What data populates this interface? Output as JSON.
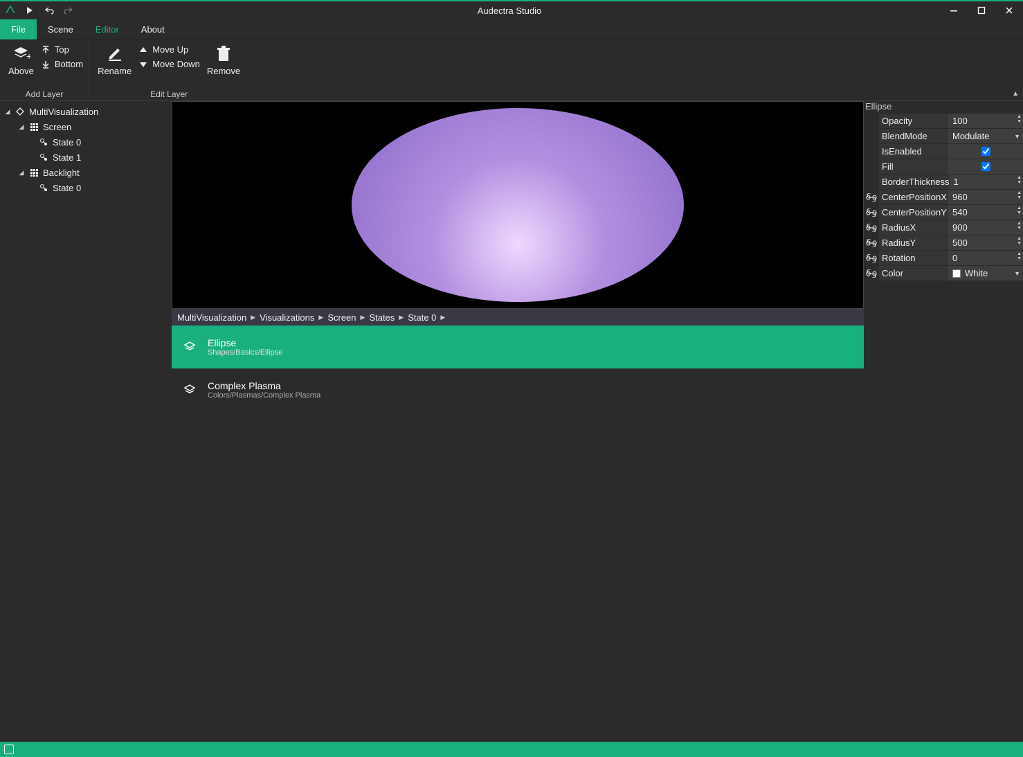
{
  "app_title": "Audectra Studio",
  "menu": {
    "file": "File",
    "scene": "Scene",
    "editor": "Editor",
    "about": "About"
  },
  "ribbon": {
    "add_layer_group": "Add Layer",
    "edit_layer_group": "Edit Layer",
    "above": "Above",
    "top": "Top",
    "bottom": "Bottom",
    "rename": "Rename",
    "move_up": "Move Up",
    "move_down": "Move Down",
    "remove": "Remove"
  },
  "tree": {
    "root": "MultiVisualization",
    "screen": "Screen",
    "state0": "State 0",
    "state1": "State 1",
    "backlight": "Backlight",
    "bl_state0": "State 0"
  },
  "breadcrumb": [
    "MultiVisualization",
    "Visualizations",
    "Screen",
    "States",
    "State 0"
  ],
  "layers": [
    {
      "title": "Ellipse",
      "path": "Shapes/Basics/Ellipse",
      "selected": true
    },
    {
      "title": "Complex Plasma",
      "path": "Colors/Plasmas/Complex Plasma",
      "selected": false
    }
  ],
  "props": {
    "header": "Ellipse",
    "rows": [
      {
        "label": "Opacity",
        "value": "100",
        "type": "spin",
        "link": false
      },
      {
        "label": "BlendMode",
        "value": "Modulate",
        "type": "dropdown",
        "link": false
      },
      {
        "label": "IsEnabled",
        "value": true,
        "type": "check",
        "link": false
      },
      {
        "label": "Fill",
        "value": true,
        "type": "check",
        "link": false
      },
      {
        "label": "BorderThickness",
        "value": "1",
        "type": "spin",
        "link": false
      },
      {
        "label": "CenterPositionX",
        "value": "960",
        "type": "spin",
        "link": true
      },
      {
        "label": "CenterPositionY",
        "value": "540",
        "type": "spin",
        "link": true
      },
      {
        "label": "RadiusX",
        "value": "900",
        "type": "spin",
        "link": true
      },
      {
        "label": "RadiusY",
        "value": "500",
        "type": "spin",
        "link": true
      },
      {
        "label": "Rotation",
        "value": "0",
        "type": "spin",
        "link": true
      },
      {
        "label": "Color",
        "value": "White",
        "type": "color",
        "link": true
      }
    ]
  }
}
